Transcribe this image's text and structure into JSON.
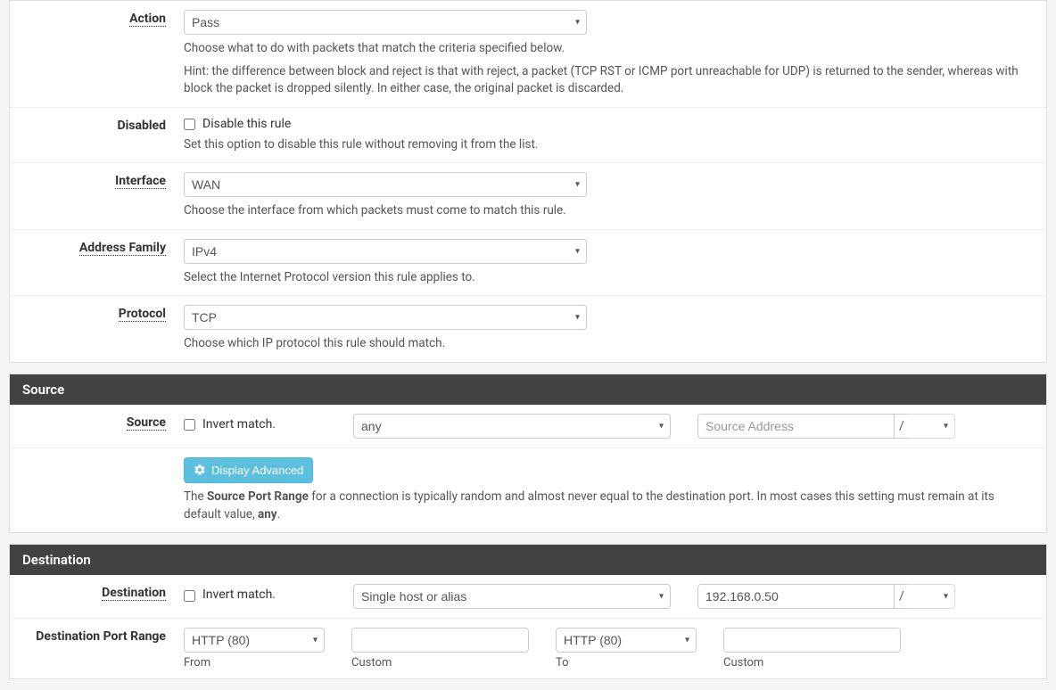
{
  "fields": {
    "action": {
      "label": "Action",
      "value": "Pass",
      "help1": "Choose what to do with packets that match the criteria specified below.",
      "help2": "Hint: the difference between block and reject is that with reject, a packet (TCP RST or ICMP port unreachable for UDP) is returned to the sender, whereas with block the packet is dropped silently. In either case, the original packet is discarded."
    },
    "disabled": {
      "label": "Disabled",
      "checkbox_label": "Disable this rule",
      "help": "Set this option to disable this rule without removing it from the list."
    },
    "interface": {
      "label": "Interface",
      "value": "WAN",
      "help": "Choose the interface from which packets must come to match this rule."
    },
    "address_family": {
      "label": "Address Family",
      "value": "IPv4",
      "help": "Select the Internet Protocol version this rule applies to."
    },
    "protocol": {
      "label": "Protocol",
      "value": "TCP",
      "help": "Choose which IP protocol this rule should match."
    }
  },
  "source": {
    "header": "Source",
    "label": "Source",
    "invert_label": "Invert match.",
    "type_value": "any",
    "address_placeholder": "Source Address",
    "slash": "/",
    "mask_value": "",
    "advanced_button": "Display Advanced",
    "help_pre": "The ",
    "help_bold": "Source Port Range",
    "help_mid": " for a connection is typically random and almost never equal to the destination port. In most cases this setting must remain at its default value, ",
    "help_bold2": "any",
    "help_end": "."
  },
  "destination": {
    "header": "Destination",
    "label": "Destination",
    "invert_label": "Invert match.",
    "type_value": "Single host or alias",
    "address_value": "192.168.0.50",
    "slash": "/",
    "mask_value": "",
    "port_label": "Destination Port Range",
    "from_value": "HTTP (80)",
    "from_custom": "",
    "to_value": "HTTP (80)",
    "to_custom": "",
    "sub_from": "From",
    "sub_custom1": "Custom",
    "sub_to": "To",
    "sub_custom2": "Custom"
  }
}
